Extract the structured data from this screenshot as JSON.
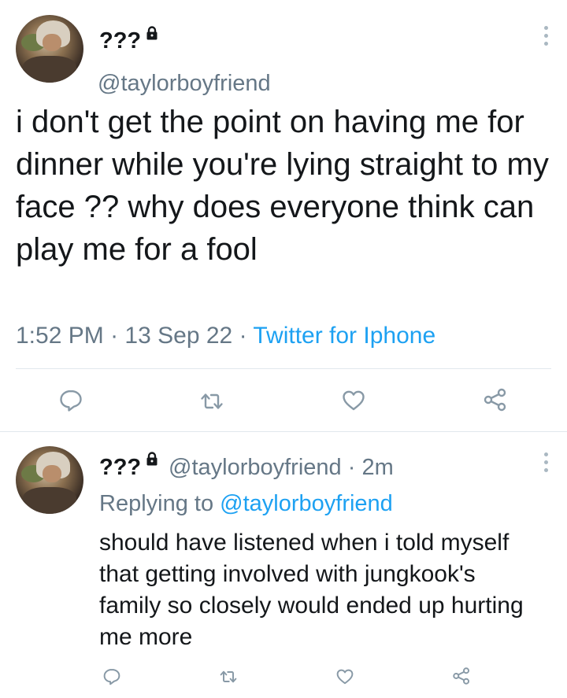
{
  "main_tweet": {
    "display_name": "???",
    "handle": "@taylorboyfriend",
    "text": "i don't get the point on having me for dinner while you're lying straight to my face ?? why does everyone think can play me for a fool",
    "time": "1:52 PM",
    "separator": "·",
    "date": "13 Sep 22",
    "source": "Twitter for Iphone"
  },
  "reply_tweet": {
    "display_name": "???",
    "handle": "@taylorboyfriend",
    "separator": "·",
    "age": "2m",
    "replying_label": "Replying to",
    "replying_to": "@taylorboyfriend",
    "text": "should have listened when i told myself that getting involved with jungkook's family so closely would ended up hurting me more"
  },
  "icons": {
    "lock": "lock-icon",
    "menu": "more-vertical-icon",
    "reply": "reply-icon",
    "retweet": "retweet-icon",
    "like": "heart-icon",
    "share": "share-icon"
  },
  "colors": {
    "text": "#14171a",
    "secondary": "#657786",
    "link": "#1da1f2",
    "divider": "#e1e8ed",
    "icon": "#8899a6"
  }
}
